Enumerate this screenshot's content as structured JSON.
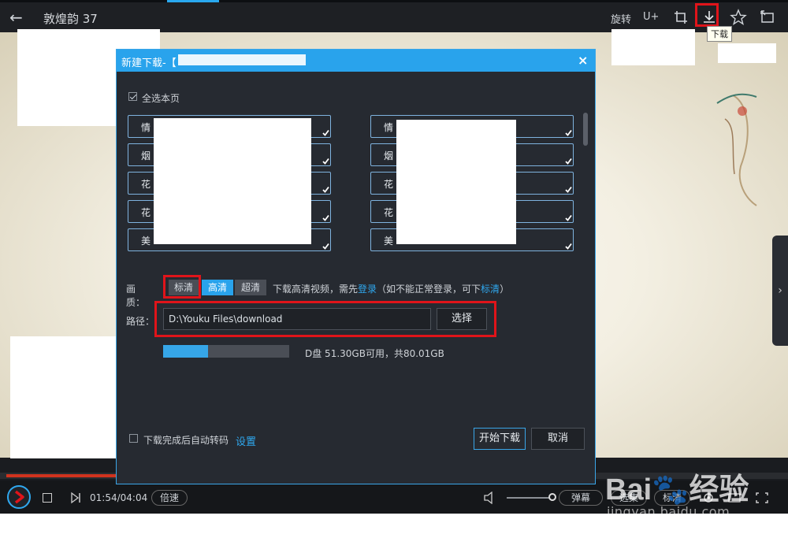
{
  "player": {
    "title": "敦煌韵 37",
    "toolbar": {
      "rotate_label": "旋转",
      "uplus_label": "U+",
      "download_tooltip": "下载"
    },
    "controls": {
      "current_time": "01:54",
      "total_time": "04:04",
      "time_display": "01:54/04:04",
      "speed_label": "倍速",
      "danmaku_label": "弹幕",
      "episodes_label": "选集",
      "quality_label": "标清",
      "progress_fraction": 0.47
    }
  },
  "dialog": {
    "title": "新建下载-【",
    "close_label": "×",
    "select_all_label": "全选本页",
    "select_all_checked": true,
    "episodes_left": [
      {
        "label": "情",
        "checked": true
      },
      {
        "label": "烟",
        "checked": true
      },
      {
        "label": "花",
        "checked": true
      },
      {
        "label": "花",
        "checked": true
      },
      {
        "label": "美",
        "checked": true
      }
    ],
    "episodes_right": [
      {
        "label": "情",
        "checked": true
      },
      {
        "label": "烟",
        "checked": true
      },
      {
        "label": "花",
        "checked": true
      },
      {
        "label": "花",
        "checked": true
      },
      {
        "label": "美",
        "checked": true
      }
    ],
    "quality": {
      "label": "画质：",
      "options": [
        "标清",
        "高清",
        "超清"
      ],
      "selected": "高清",
      "note_prefix": "下载高清视频，需先",
      "note_login": "登录",
      "note_middle": "（如不能正常登录，可下",
      "note_std": "标清",
      "note_suffix": "）"
    },
    "path": {
      "label": "路径：",
      "value": "D:\\Youku Files\\download",
      "select_label": "选择"
    },
    "disk": {
      "text": "D盘 51.30GB可用，共80.01GB",
      "used_fraction": 0.359
    },
    "auto_transcode": {
      "label": "下载完成后自动转码",
      "checked": false,
      "settings_label": "设置"
    },
    "start_label": "开始下载",
    "cancel_label": "取消"
  },
  "watermark": {
    "brand": "Bai",
    "brand_cn": "经验",
    "url": "jingyan.baidu.com"
  },
  "colors": {
    "accent": "#29a3ec",
    "highlight_red": "#e0141a",
    "progress_red": "#d0331e"
  }
}
